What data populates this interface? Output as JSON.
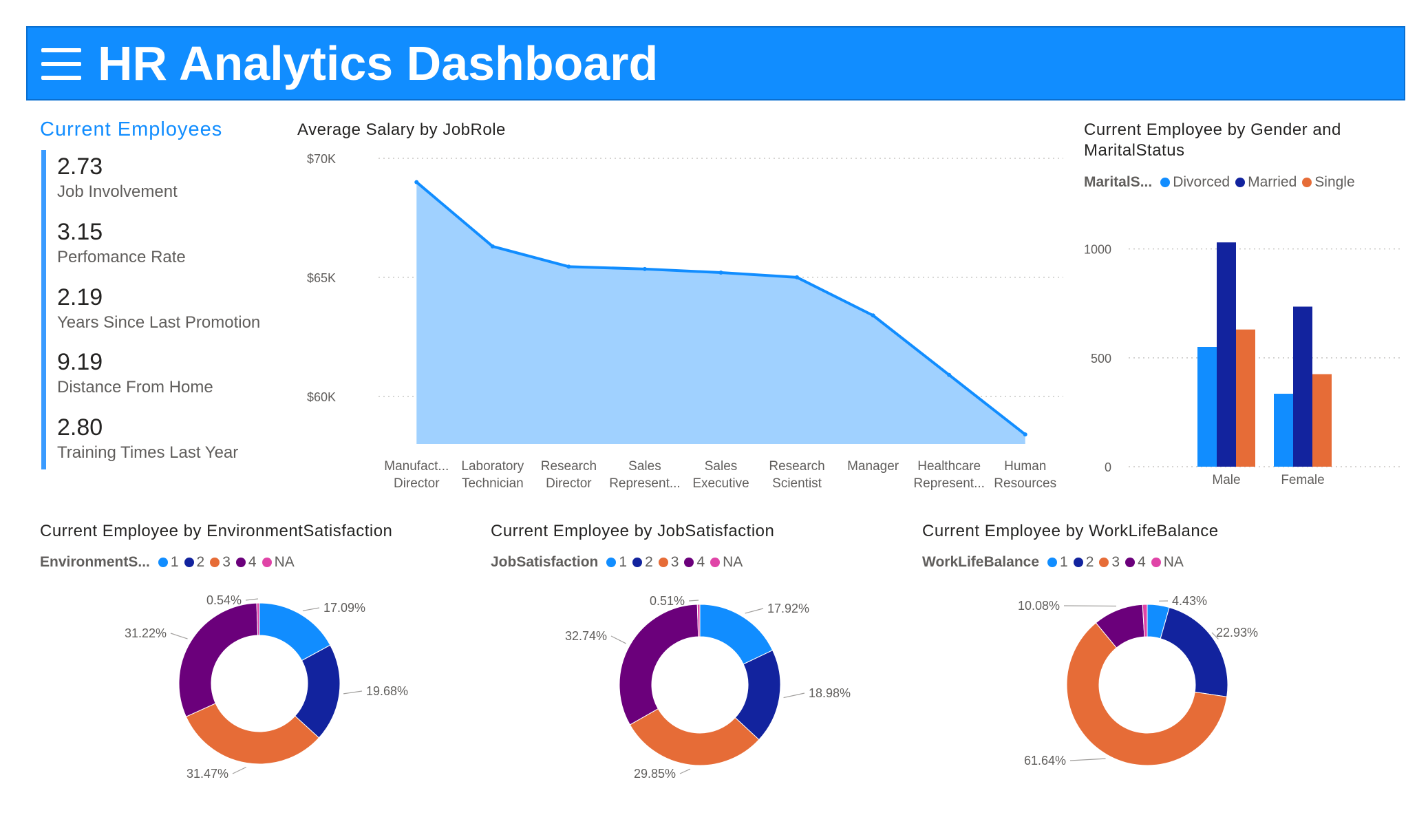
{
  "header": {
    "title": "HR Analytics Dashboard"
  },
  "kpi": {
    "title": "Current Employees",
    "items": [
      {
        "value": "2.73",
        "label": "Job Involvement"
      },
      {
        "value": "3.15",
        "label": "Perfomance Rate"
      },
      {
        "value": "2.19",
        "label": "Years Since Last Promotion"
      },
      {
        "value": "9.19",
        "label": "Distance From Home"
      },
      {
        "value": "2.80",
        "label": "Training Times Last Year"
      }
    ]
  },
  "colors": {
    "accent": "#118dff",
    "c1": "#118dff",
    "c2": "#12239e",
    "c3": "#e66c37",
    "c4": "#6b007b",
    "cNA": "#e044a7",
    "area_fill": "#a0d1ff",
    "axis_text": "#605e5c"
  },
  "chart_data": [
    {
      "type": "area",
      "title": "Average Salary by JobRole",
      "categories": [
        [
          "Manufact...",
          "Director"
        ],
        [
          "Laboratory",
          "Technician"
        ],
        [
          "Research",
          "Director"
        ],
        [
          "Sales",
          "Represent..."
        ],
        [
          "Sales",
          "Executive"
        ],
        [
          "Research",
          "Scientist"
        ],
        [
          "Manager"
        ],
        [
          "Healthcare",
          "Represent..."
        ],
        [
          "Human",
          "Resources"
        ]
      ],
      "values": [
        69000,
        66300,
        65450,
        65350,
        65200,
        65000,
        63400,
        60900,
        58400
      ],
      "yticks": [
        60000,
        65000,
        70000
      ],
      "ytick_labels": [
        "$60K",
        "$65K",
        "$70K"
      ],
      "ylim": [
        58000,
        70000
      ],
      "grid": true
    },
    {
      "type": "bar",
      "title": "Current Employee by Gender and MaritalStatus",
      "legend_title": "MaritalS...",
      "categories": [
        "Male",
        "Female"
      ],
      "series": [
        {
          "name": "Divorced",
          "values": [
            550,
            335
          ]
        },
        {
          "name": "Married",
          "values": [
            1030,
            735
          ]
        },
        {
          "name": "Single",
          "values": [
            630,
            425
          ]
        }
      ],
      "yticks": [
        0,
        500,
        1000
      ],
      "ylim": [
        0,
        1100
      ],
      "grid": true,
      "legend_position": "top-left"
    },
    {
      "type": "pie",
      "title": "Current Employee by EnvironmentSatisfaction",
      "legend_title": "EnvironmentS...",
      "labels": [
        "1",
        "2",
        "3",
        "4",
        "NA"
      ],
      "values": [
        17.09,
        19.68,
        31.47,
        31.22,
        0.54
      ],
      "value_labels": [
        "17.09%",
        "19.68%",
        "31.47%",
        "31.22%",
        "0.54%"
      ]
    },
    {
      "type": "pie",
      "title": "Current Employee by JobSatisfaction",
      "legend_title": "JobSatisfaction",
      "labels": [
        "1",
        "2",
        "3",
        "4",
        "NA"
      ],
      "values": [
        17.92,
        18.98,
        29.85,
        32.74,
        0.51
      ],
      "value_labels": [
        "17.92%",
        "18.98%",
        "29.85%",
        "32.74%",
        "0.51%"
      ]
    },
    {
      "type": "pie",
      "title": "Current Employee by WorkLifeBalance",
      "legend_title": "WorkLifeBalance",
      "labels": [
        "1",
        "2",
        "3",
        "4",
        "NA"
      ],
      "values": [
        4.43,
        22.93,
        61.64,
        10.08,
        0.92
      ],
      "value_labels": [
        "4.43%",
        "22.93%",
        "61.64%",
        "10.08%",
        ""
      ]
    }
  ]
}
